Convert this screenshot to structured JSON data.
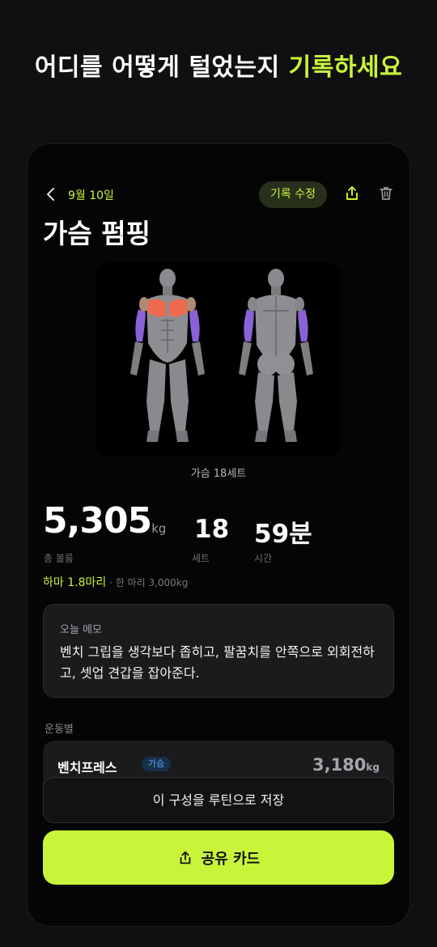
{
  "headline": {
    "text": "어디를 어떻게 털었는지 ",
    "accent": "기록하세요"
  },
  "topbar": {
    "date": "9월 10일",
    "edit_label": "기록 수정"
  },
  "workout": {
    "title": "가슴 펌핑",
    "body_caption": "가슴 18세트",
    "volume": "5,305",
    "volume_unit": "kg",
    "volume_label": "총 볼륨",
    "sets": "18",
    "sets_label": "세트",
    "time": "59분",
    "time_label": "시간",
    "compare_hl": "하마 1.8마리",
    "compare_sub": " · 한 마리 3,000kg"
  },
  "memo": {
    "label": "오늘 메모",
    "text": "벤치 그립을 생각보다 좁히고, 팔꿈치를 안쪽으로 외회전하고, 셋업 견갑을 잡아준다."
  },
  "exercises_section": {
    "label": "운동별",
    "items": [
      {
        "name": "벤치프레스",
        "tag": "가슴",
        "volume": "3,180",
        "unit": "kg"
      }
    ]
  },
  "actions": {
    "routine_label": "이 구성을 루틴으로 저장",
    "share_label": "공유 카드"
  },
  "colors": {
    "accent": "#c8f53a",
    "chest": "#ee6a4f",
    "arm": "#8a62d8",
    "tag_blue": "#5aa8ff"
  }
}
